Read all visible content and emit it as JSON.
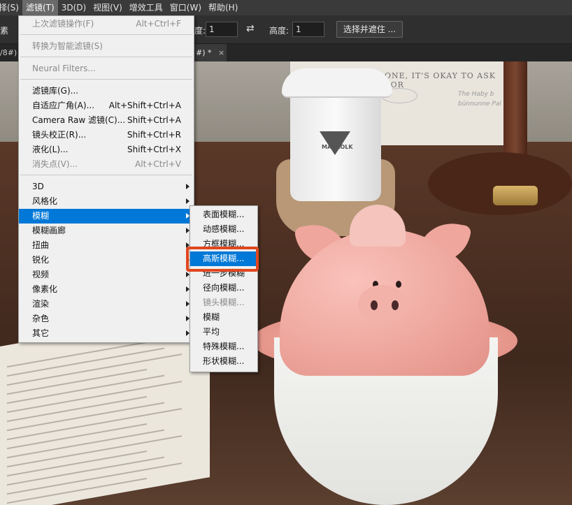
{
  "menubar": {
    "items": [
      "择(S)",
      "滤镜(T)",
      "3D(D)",
      "视图(V)",
      "增效工具",
      "窗口(W)",
      "帮助(H)"
    ],
    "active_index": 1
  },
  "options": {
    "left_label": "素",
    "width_label": "度:",
    "width_value": "1",
    "height_label": "高度:",
    "height_value": "1",
    "select_mask_button": "选择并遮住 ..."
  },
  "tabs": {
    "left_fragment": "/8#)",
    "current_fragment": "#) *",
    "close": "×"
  },
  "photo": {
    "card_text": "ONE, IT'S OKAY TO ASK FOR",
    "card_hand_1": "The Haby b",
    "card_hand_2": "bünnunne Pal",
    "card_oval": "t",
    "cup_brand": "MARAOLK"
  },
  "filter_menu": {
    "items": [
      {
        "label": "上次滤镜操作(F)",
        "shortcut": "Alt+Ctrl+F",
        "disabled": true
      },
      {
        "sep": true
      },
      {
        "label": "转换为智能滤镜(S)",
        "disabled": true
      },
      {
        "sep": true
      },
      {
        "label": "Neural Filters...",
        "disabled": true
      },
      {
        "sep": true
      },
      {
        "label": "滤镜库(G)..."
      },
      {
        "label": "自适应广角(A)...",
        "shortcut": "Alt+Shift+Ctrl+A"
      },
      {
        "label": "Camera Raw 滤镜(C)...",
        "shortcut": "Shift+Ctrl+A"
      },
      {
        "label": "镜头校正(R)...",
        "shortcut": "Shift+Ctrl+R"
      },
      {
        "label": "液化(L)...",
        "shortcut": "Shift+Ctrl+X"
      },
      {
        "label": "消失点(V)...",
        "shortcut": "Alt+Ctrl+V",
        "disabled": true
      },
      {
        "sep": true
      },
      {
        "label": "3D",
        "submenu": true
      },
      {
        "label": "风格化",
        "submenu": true
      },
      {
        "label": "模糊",
        "submenu": true,
        "highlighted": true
      },
      {
        "label": "模糊画廊",
        "submenu": true
      },
      {
        "label": "扭曲",
        "submenu": true
      },
      {
        "label": "锐化",
        "submenu": true
      },
      {
        "label": "视频",
        "submenu": true
      },
      {
        "label": "像素化",
        "submenu": true
      },
      {
        "label": "渲染",
        "submenu": true
      },
      {
        "label": "杂色",
        "submenu": true
      },
      {
        "label": "其它",
        "submenu": true
      }
    ]
  },
  "blur_submenu": {
    "items": [
      {
        "label": "表面模糊..."
      },
      {
        "label": "动感模糊..."
      },
      {
        "label": "方框模糊..."
      },
      {
        "label": "高斯模糊...",
        "highlighted": true
      },
      {
        "label": "进一步模糊"
      },
      {
        "label": "径向模糊..."
      },
      {
        "label": "镜头模糊...",
        "disabled": true
      },
      {
        "label": "模糊"
      },
      {
        "label": "平均"
      },
      {
        "label": "特殊模糊..."
      },
      {
        "label": "形状模糊..."
      }
    ]
  },
  "colors": {
    "highlight": "#0078d7",
    "callout": "#e0471f"
  }
}
